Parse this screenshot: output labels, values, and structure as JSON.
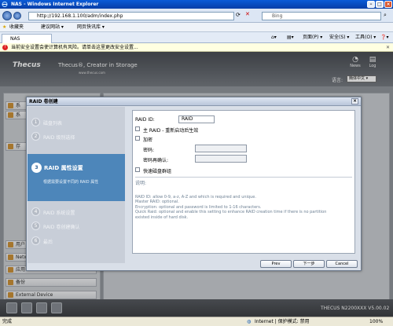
{
  "window": {
    "title": "NAS - Windows Internet Explorer"
  },
  "address": {
    "url": "http://192.168.1.100/adm/index.php",
    "search_placeholder": "Bing"
  },
  "favorites": {
    "label": "收藏夹",
    "items": [
      "建议网站 ▾",
      "网页快讯库 ▾"
    ]
  },
  "tab": {
    "label": "NAS"
  },
  "commandbar": {
    "page": "页面(P) ▾",
    "safety": "安全(S) ▾",
    "tools": "工具(O) ▾",
    "help": "❓▾"
  },
  "infobar": {
    "text": "当前安全设置会使计算机有风险。请单击这里更改安全设置..."
  },
  "app": {
    "logo": "Thecus",
    "slogan": "Thecus®, Creator in Storage",
    "site": "www.thecus.com",
    "header_icons": [
      {
        "name": "news",
        "label": "News"
      },
      {
        "name": "log",
        "label": "Log"
      }
    ],
    "language_label": "语言:",
    "language_value": "簡体中文",
    "sidebar_items": [
      "系",
      "系",
      "存",
      "用户",
      "Netw",
      "应用",
      "备份",
      "External Device"
    ],
    "footer_version": "THECUS N2200XXX V5.00.02"
  },
  "modal": {
    "title": "RAID 卷创建",
    "steps": [
      {
        "num": "1",
        "label": "磁盘列表"
      },
      {
        "num": "2",
        "label": "RAID 级别选择"
      },
      {
        "num": "3",
        "label": "RAID 属性设置",
        "desc": "根据需要设置不同的 RAID 属性"
      },
      {
        "num": "4",
        "label": "RAID 系统设置"
      },
      {
        "num": "5",
        "label": "RAID 卷创建确认"
      },
      {
        "num": "6",
        "label": "最后"
      }
    ],
    "form": {
      "raid_id_label": "RAID ID:",
      "raid_id_value": "RAID",
      "master_label": "主 RAID - 重新启动后生效",
      "encrypt_label": "加密",
      "password_label": "密码:",
      "password_confirm_label": "密码再确认:",
      "quick_raid_label": "快速磁盘群组"
    },
    "notes": {
      "heading": "说明:",
      "lines": [
        "RAID ID: allow 0-9, a-z, A-Z and which is required and unique.",
        "Master RAID: optional.",
        "Encryption: optional and password is limited to 1-16 characters.",
        "Quick Raid: optional and enable this setting to enhance RAID creation time if there is no partition",
        "existed inside of hard disk."
      ]
    },
    "buttons": {
      "prev": "Prev",
      "next": "下一步",
      "cancel": "Cancel"
    }
  },
  "statusbar": {
    "status": "完成",
    "zone": "Internet | 保护模式: 禁用",
    "zoom": "100%"
  }
}
